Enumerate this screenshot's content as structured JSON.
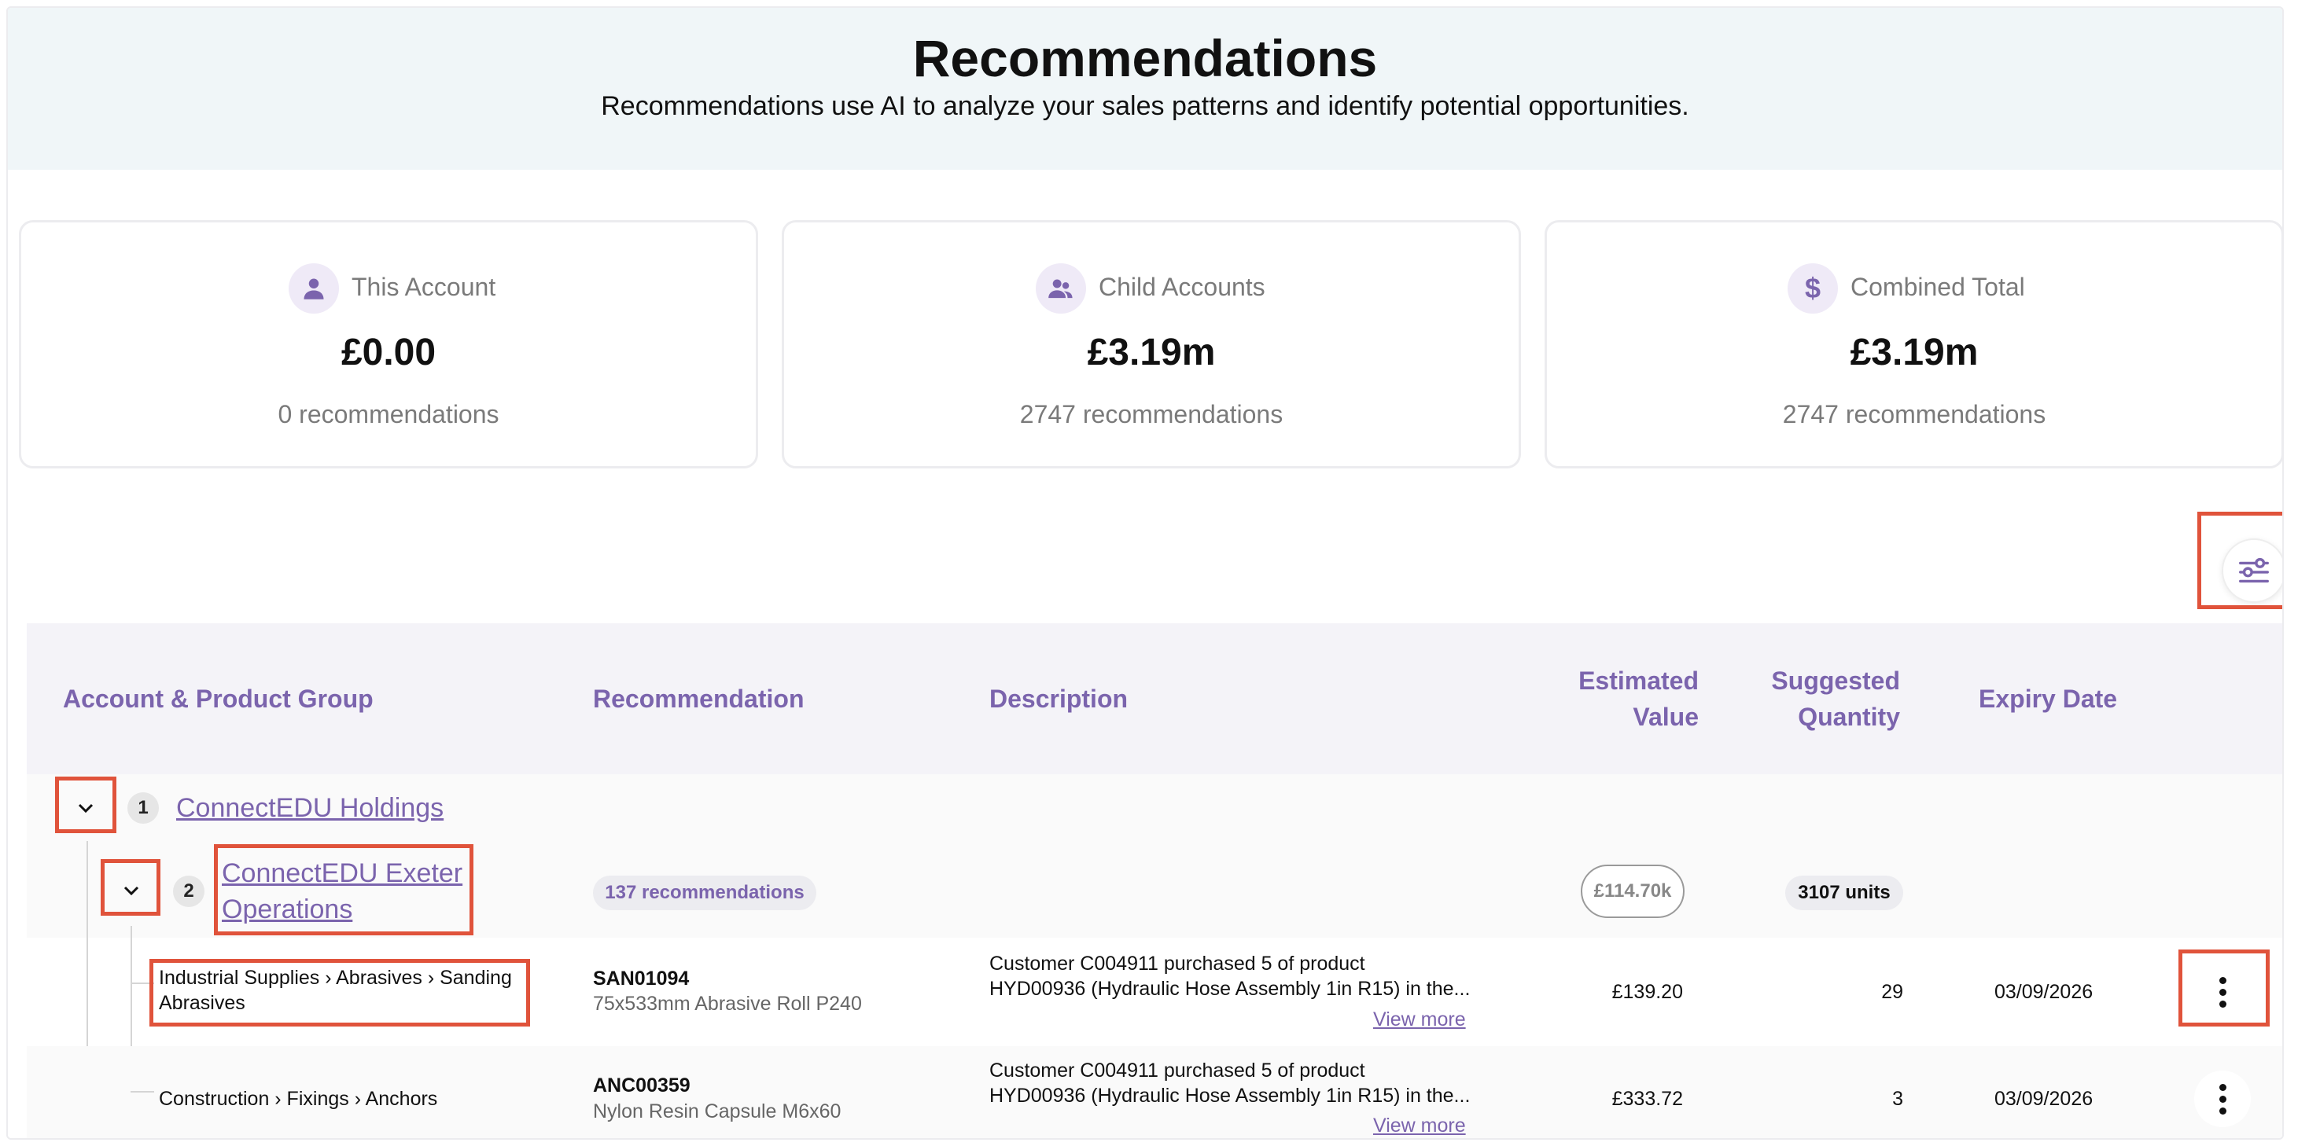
{
  "header": {
    "title": "Recommendations",
    "subtitle": "Recommendations use AI to analyze your sales patterns and identify potential opportunities."
  },
  "cards": [
    {
      "label": "This Account",
      "value": "£0.00",
      "sub": "0 recommendations",
      "icon": "user-icon"
    },
    {
      "label": "Child Accounts",
      "value": "£3.19m",
      "sub": "2747 recommendations",
      "icon": "users-icon"
    },
    {
      "label": "Combined Total",
      "value": "£3.19m",
      "sub": "2747 recommendations",
      "icon": "dollar-icon"
    }
  ],
  "table": {
    "headers": {
      "account": "Account & Product Group",
      "recommendation": "Recommendation",
      "description": "Description",
      "estimated_value_1": "Estimated",
      "estimated_value_2": "Value",
      "suggested_quantity_1": "Suggested",
      "suggested_quantity_2": "Quantity",
      "expiry": "Expiry Date"
    },
    "level1": {
      "num": "1",
      "name": "ConnectEDU Holdings"
    },
    "level2": {
      "num": "2",
      "name_line1": "ConnectEDU Exeter",
      "name_line2": "Operations",
      "recommendations": "137 recommendations",
      "value": "£114.70k",
      "units": "3107 units"
    },
    "rows": [
      {
        "group_line1": "Industrial Supplies › Abrasives › Sanding",
        "group_line2": "Abrasives",
        "sku": "SAN01094",
        "product": "75x533mm Abrasive Roll P240",
        "desc_line1": "Customer C004911 purchased 5 of product",
        "desc_line2": "HYD00936 (Hydraulic Hose Assembly 1in R15) in the...",
        "view_more": "View more",
        "value": "£139.20",
        "qty": "29",
        "expiry": "03/09/2026"
      },
      {
        "group_line1": "Construction › Fixings › Anchors",
        "group_line2": "",
        "sku": "ANC00359",
        "product": "Nylon Resin Capsule M6x60",
        "desc_line1": "Customer C004911 purchased 5 of product",
        "desc_line2": "HYD00936 (Hydraulic Hose Assembly 1in R15) in the...",
        "view_more": "View more",
        "value": "£333.72",
        "qty": "3",
        "expiry": "03/09/2026"
      }
    ]
  },
  "colors": {
    "accent": "#7b64ad",
    "highlight": "#e0533b",
    "hero_bg": "#f0f6f8"
  }
}
